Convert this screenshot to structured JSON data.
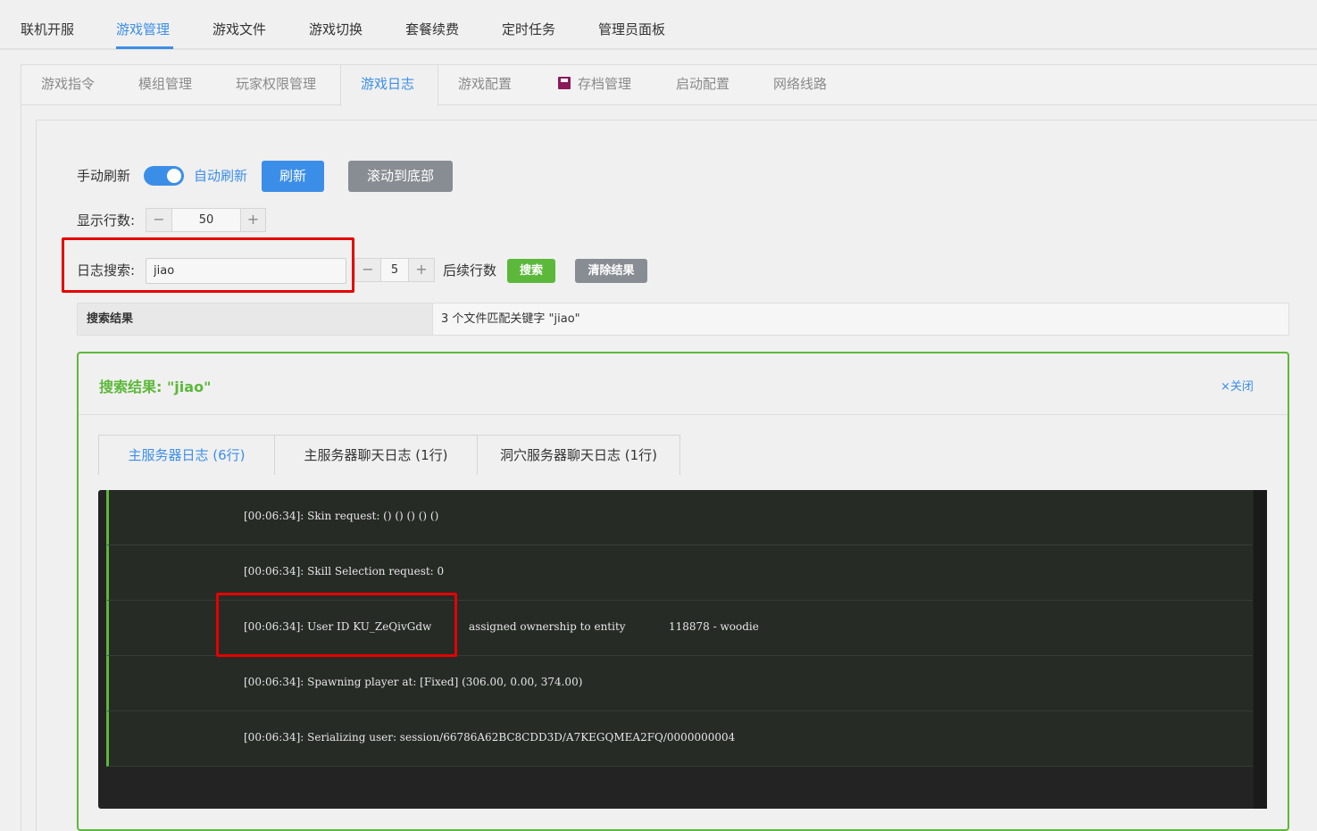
{
  "topnav": {
    "items": [
      "联机开服",
      "游戏管理",
      "游戏文件",
      "游戏切换",
      "套餐续费",
      "定时任务",
      "管理员面板"
    ],
    "active": "游戏管理"
  },
  "subtabs": {
    "items": [
      "游戏指令",
      "模组管理",
      "玩家权限管理",
      "游戏日志",
      "游戏配置",
      "存档管理",
      "启动配置",
      "网络线路"
    ],
    "active": "游戏日志"
  },
  "controls": {
    "manual_refresh": "手动刷新",
    "auto_refresh": "自动刷新",
    "auto_refresh_on": true,
    "refresh_btn": "刷新",
    "scroll_bottom_btn": "滚动到底部",
    "lines_label": "显示行数:",
    "lines_value": "50",
    "search_label": "日志搜索:",
    "search_value": "jiao",
    "after_lines_value": "5",
    "after_lines_label": "后续行数",
    "search_btn": "搜索",
    "clear_btn": "清除结果"
  },
  "summary": {
    "key": "搜索结果",
    "value": "3 个文件匹配关键字 \"jiao\""
  },
  "results": {
    "title": "搜索结果: \"jiao\"",
    "close": "×关闭",
    "tabs": [
      "主服务器日志 (6行)",
      "主服务器聊天日志 (1行)",
      "洞穴服务器聊天日志 (1行)"
    ],
    "active_tab": 0,
    "lines": [
      "[00:06:34]: Skin request: () () () () ()",
      "[00:06:34]: Skill Selection request: 0",
      "[00:06:34]: User ID KU_ZeQivGdw",
      "[00:06:34]: Spawning player at: [Fixed] (306.00, 0.00, 374.00)",
      "[00:06:34]: Serializing user: session/66786A62BC8CDD3D/A7KEGQMEA2FQ/0000000004"
    ],
    "line3_part2": "assigned ownership to entity",
    "line3_part3": "118878 - woodie"
  },
  "colors": {
    "accent": "#3b8ee8",
    "green": "#5cb83a",
    "highlight": "#e60000"
  }
}
